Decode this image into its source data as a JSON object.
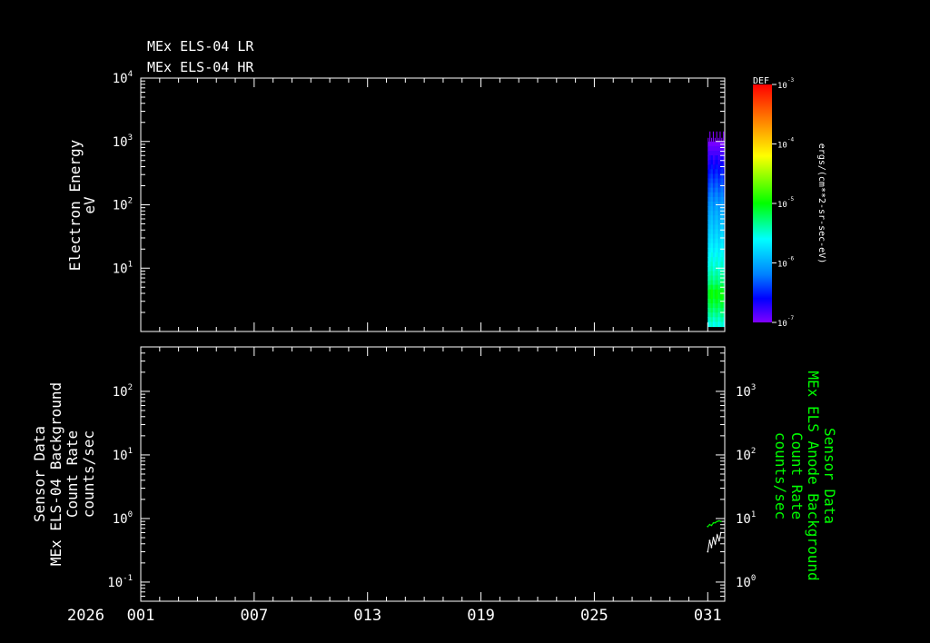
{
  "titles": [
    "MEx ELS-04 LR",
    "MEx ELS-04 HR"
  ],
  "colors": {
    "background": "#000000",
    "axis": "#ffffff",
    "right_axis": "#00ff00",
    "anode_trace": "#00ff00",
    "background_trace": "#ffffff"
  },
  "x_axis": {
    "year_label": "2026",
    "tick_labels": [
      "001",
      "007",
      "013",
      "019",
      "025",
      "031"
    ],
    "tick_days": [
      1,
      7,
      13,
      19,
      25,
      31
    ],
    "range_days": [
      1,
      31.9
    ]
  },
  "colorbar": {
    "header": "DEF",
    "unit_label": "ergs/(cm**2-sr-sec-eV)",
    "ticks": [
      {
        "base": "10",
        "exp": "-3"
      },
      {
        "base": "10",
        "exp": "-4"
      },
      {
        "base": "10",
        "exp": "-5"
      },
      {
        "base": "10",
        "exp": "-6"
      },
      {
        "base": "10",
        "exp": "-7"
      }
    ],
    "range_exp": [
      -7,
      -3
    ],
    "palette": [
      "#ff0000",
      "#ff8000",
      "#ffff00",
      "#00ff00",
      "#00ffff",
      "#0080ff",
      "#0000ff",
      "#8000ff"
    ]
  },
  "chart_data": [
    {
      "type": "heatmap",
      "ylabel_lines": [
        "Electron Energy",
        "eV"
      ],
      "yscale": "log",
      "ylim": [
        1,
        10000
      ],
      "yticks": [
        {
          "value": 10,
          "base": "10",
          "exp": "1"
        },
        {
          "value": 100,
          "base": "10",
          "exp": "2"
        },
        {
          "value": 1000,
          "base": "10",
          "exp": "3"
        },
        {
          "value": 10000,
          "base": "10",
          "exp": "4"
        }
      ],
      "data_span_days": [
        31.0,
        31.9
      ],
      "energy_top_eV": 1000,
      "energy_bottom_eV": 1.2,
      "profile_eV_vs_log10_def": [
        [
          1.2,
          -5.6
        ],
        [
          2.5,
          -5.2
        ],
        [
          4,
          -5.0
        ],
        [
          6,
          -5.3
        ],
        [
          10,
          -5.5
        ],
        [
          30,
          -5.8
        ],
        [
          100,
          -6.1
        ],
        [
          300,
          -6.5
        ],
        [
          1000,
          -7.0
        ]
      ]
    },
    {
      "type": "line",
      "ylabel_lines": [
        "Sensor Data",
        "MEx ELS-04 Background",
        "Count Rate",
        "counts/sec"
      ],
      "yscale": "log",
      "ylim": [
        0.05,
        500
      ],
      "yticks": [
        {
          "value": 0.1,
          "base": "10",
          "exp": "-1"
        },
        {
          "value": 1,
          "base": "10",
          "exp": "0"
        },
        {
          "value": 10,
          "base": "10",
          "exp": "1"
        },
        {
          "value": 100,
          "base": "10",
          "exp": "2"
        }
      ],
      "right_ylabel_lines": [
        "Sensor Data",
        "MEx ELS Anode Background",
        "Count Rate",
        "counts/sec"
      ],
      "right_ylim": [
        0.5,
        5000
      ],
      "right_yticks": [
        {
          "value": 1,
          "base": "10",
          "exp": "0"
        },
        {
          "value": 10,
          "base": "10",
          "exp": "1"
        },
        {
          "value": 100,
          "base": "10",
          "exp": "2"
        },
        {
          "value": 1000,
          "base": "10",
          "exp": "3"
        }
      ],
      "series": [
        {
          "axis": "left",
          "color": "#ffffff",
          "x": [
            31.0,
            31.1,
            31.2,
            31.3,
            31.4,
            31.5,
            31.6,
            31.7
          ],
          "y": [
            0.3,
            0.45,
            0.35,
            0.5,
            0.4,
            0.55,
            0.45,
            0.6
          ]
        },
        {
          "axis": "right",
          "color": "#00ff00",
          "x": [
            31.0,
            31.1,
            31.2,
            31.3,
            31.4,
            31.5,
            31.6,
            31.7
          ],
          "y": [
            7.5,
            8.0,
            7.8,
            8.5,
            8.6,
            9.0,
            9.2,
            9.0
          ]
        }
      ]
    }
  ]
}
